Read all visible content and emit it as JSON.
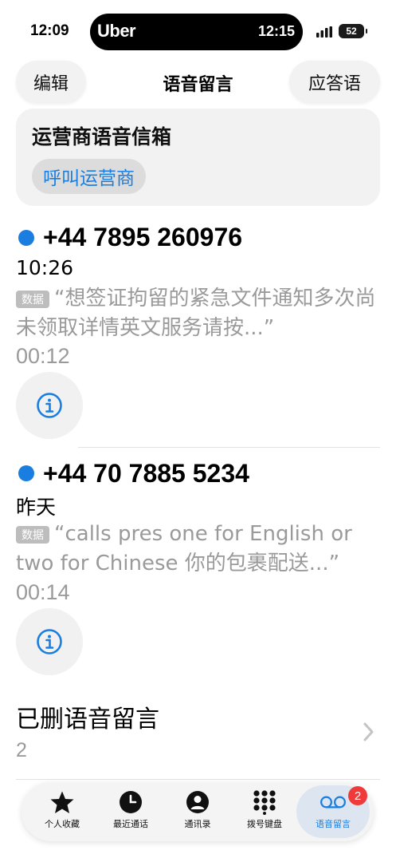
{
  "status_bar": {
    "time": "12:09",
    "island_app": "Uber",
    "island_time": "12:15",
    "battery": "52"
  },
  "header": {
    "edit": "编辑",
    "title": "语音留言",
    "greeting": "应答语"
  },
  "carrier": {
    "title": "运营商语音信箱",
    "call_button": "呼叫运营商"
  },
  "voicemails": [
    {
      "number": "+44 7895 260976",
      "time": "10:26",
      "tag": "数据",
      "transcript": "“想签证拘留的紧急文件通知多次尚未领取详情英文服务请按...”",
      "duration": "00:12"
    },
    {
      "number": "+44 70 7885 5234",
      "time": "昨天",
      "tag": "数据",
      "transcript": "“calls pres one for English or two for Chinese 你的包裹配送...”",
      "duration": "00:14"
    }
  ],
  "deleted": {
    "title": "已删语音留言",
    "count": "2"
  },
  "tabs": [
    {
      "label": "个人收藏",
      "icon": "star-icon"
    },
    {
      "label": "最近通话",
      "icon": "clock-icon"
    },
    {
      "label": "通讯录",
      "icon": "person-icon"
    },
    {
      "label": "拨号键盘",
      "icon": "keypad-icon"
    },
    {
      "label": "语音留言",
      "icon": "voicemail-icon"
    }
  ],
  "voicemail_badge": "2",
  "colors": {
    "accent": "#1a7ee0",
    "badge": "#f03a3a",
    "secondary_text": "#9a9a9a"
  }
}
